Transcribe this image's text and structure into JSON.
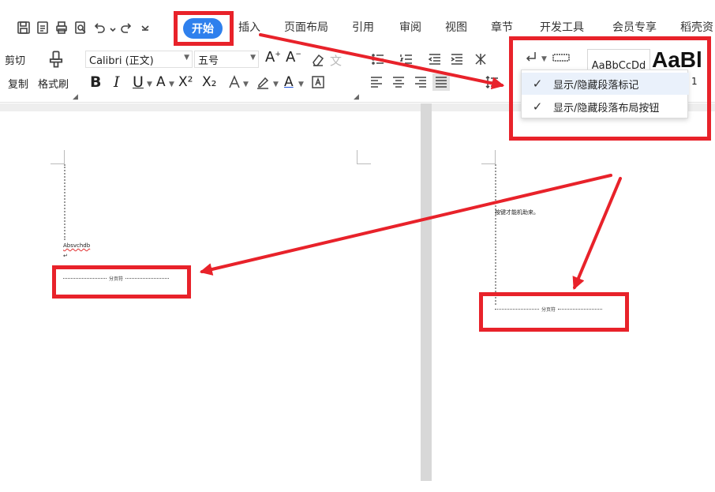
{
  "tabs": {
    "active": "开始",
    "items": [
      "插入",
      "页面布局",
      "引用",
      "审阅",
      "视图",
      "章节",
      "开发工具",
      "会员专享",
      "稻壳资"
    ]
  },
  "clipboard": {
    "cut": "剪切",
    "copy": "复制",
    "format_painter": "格式刷"
  },
  "font": {
    "family": "Calibri (正文)",
    "size": "五号"
  },
  "format_buttons": {
    "bold": "B",
    "italic": "I",
    "underline": "U",
    "superscript": "X²",
    "subscript": "X₂"
  },
  "styles": {
    "normal_preview": "AaBbCcDd",
    "heading_preview": "AaBl",
    "heading_suffix": "1"
  },
  "dropdown": {
    "items": [
      {
        "label": "显示/隐藏段落标记",
        "checked": true,
        "highlighted": true
      },
      {
        "label": "显示/隐藏段落布局按钮",
        "checked": true,
        "highlighted": false
      }
    ]
  },
  "document": {
    "left_page": {
      "text": "Absvchdb",
      "mark": "↵",
      "page_break_label": "分页符"
    },
    "right_page": {
      "text": "按键才能机助来。",
      "page_break_label": "分页符"
    }
  },
  "annotation": {
    "color": "#e8222a"
  },
  "colors": {
    "active_tab": "#2f80ed"
  }
}
